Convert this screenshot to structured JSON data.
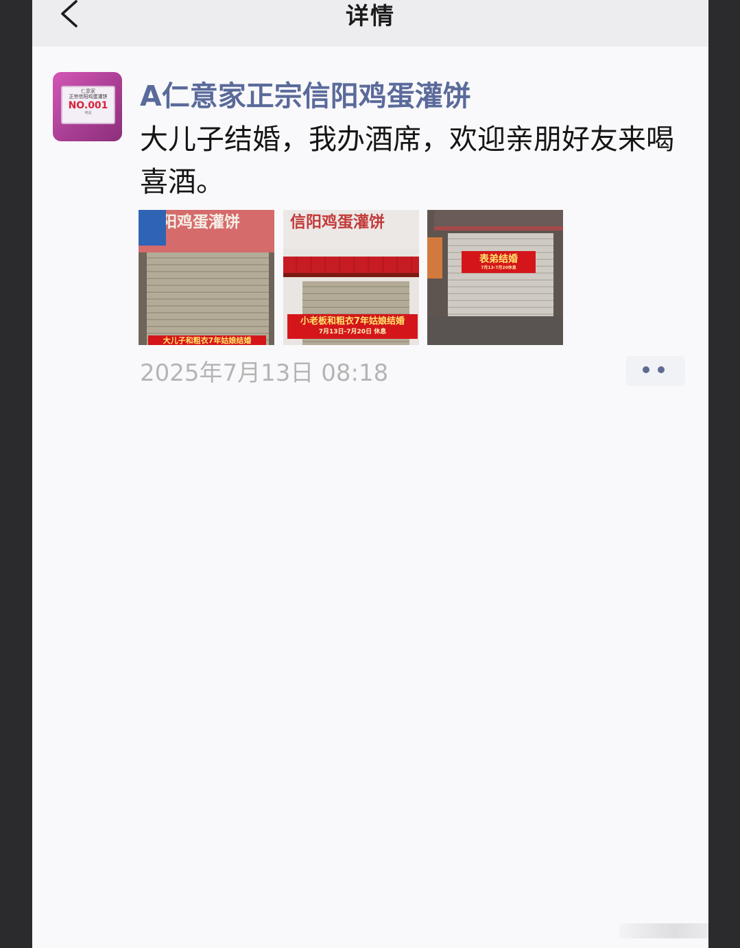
{
  "nav": {
    "title": "详情"
  },
  "post": {
    "avatar": {
      "line1": "仁意家",
      "line2": "正宗信阳鸡蛋灌饼",
      "line3": "NO.001",
      "line4": "电话"
    },
    "author": "A仁意家正宗信阳鸡蛋灌饼",
    "text": "大儿子结婚，我办酒席，欢迎亲朋好友来喝喜酒。",
    "photos": [
      {
        "sign": "信阳鸡蛋灌饼",
        "banner": "大儿子和粗衣7年姑娘结婚"
      },
      {
        "sign": "信阳鸡蛋灌饼",
        "banner": "小老板和粗衣7年姑娘结婚",
        "banner_sub": "7月13日-7月20日 休息"
      },
      {
        "banner": "表弟结婚",
        "banner_sub": "7月13-7月20休息"
      }
    ],
    "timestamp": "2025年7月13日 08:18"
  }
}
